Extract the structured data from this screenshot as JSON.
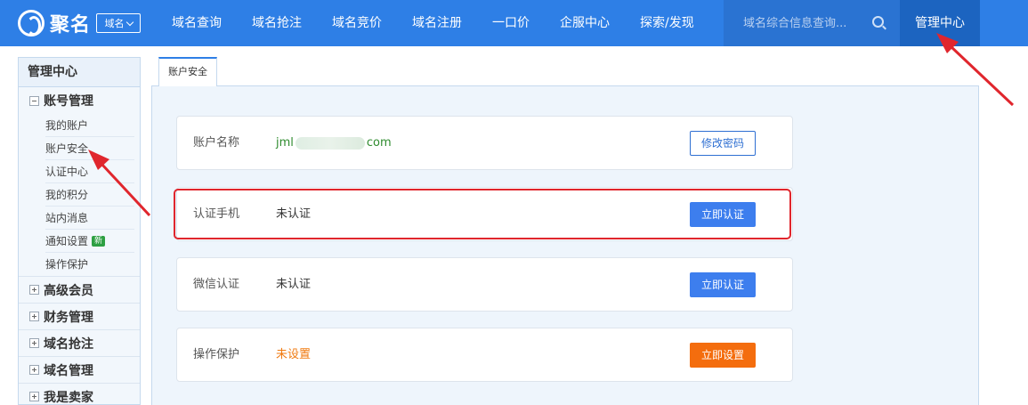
{
  "header": {
    "logo_text": "聚名",
    "domain_select": "域名",
    "nav": [
      "域名查询",
      "域名抢注",
      "域名竞价",
      "域名注册",
      "一口价",
      "企服中心",
      "探索/发现"
    ],
    "search_placeholder": "域名综合信息查询...",
    "management": "管理中心"
  },
  "sidebar": {
    "title": "管理中心",
    "account_group": {
      "label": "账号管理",
      "items": [
        "我的账户",
        "账户安全",
        "认证中心",
        "我的积分",
        "站内消息",
        "通知设置",
        "操作保护"
      ],
      "new_badge": "新"
    },
    "groups": [
      "高级会员",
      "财务管理",
      "域名抢注",
      "域名管理",
      "我是卖家"
    ]
  },
  "main": {
    "tab": "账户安全",
    "cards": [
      {
        "label": "账户名称",
        "value_prefix": "jml",
        "value_suffix": "com",
        "button": "修改密码"
      },
      {
        "label": "认证手机",
        "value": "未认证",
        "button": "立即认证"
      },
      {
        "label": "微信认证",
        "value": "未认证",
        "button": "立即认证"
      },
      {
        "label": "操作保护",
        "value": "未设置",
        "button": "立即设置"
      }
    ]
  },
  "colors": {
    "brand": "#2e7fe6",
    "highlight": "#e0262d",
    "primary_button": "#3d7eee",
    "warning_button": "#f46d0e"
  }
}
